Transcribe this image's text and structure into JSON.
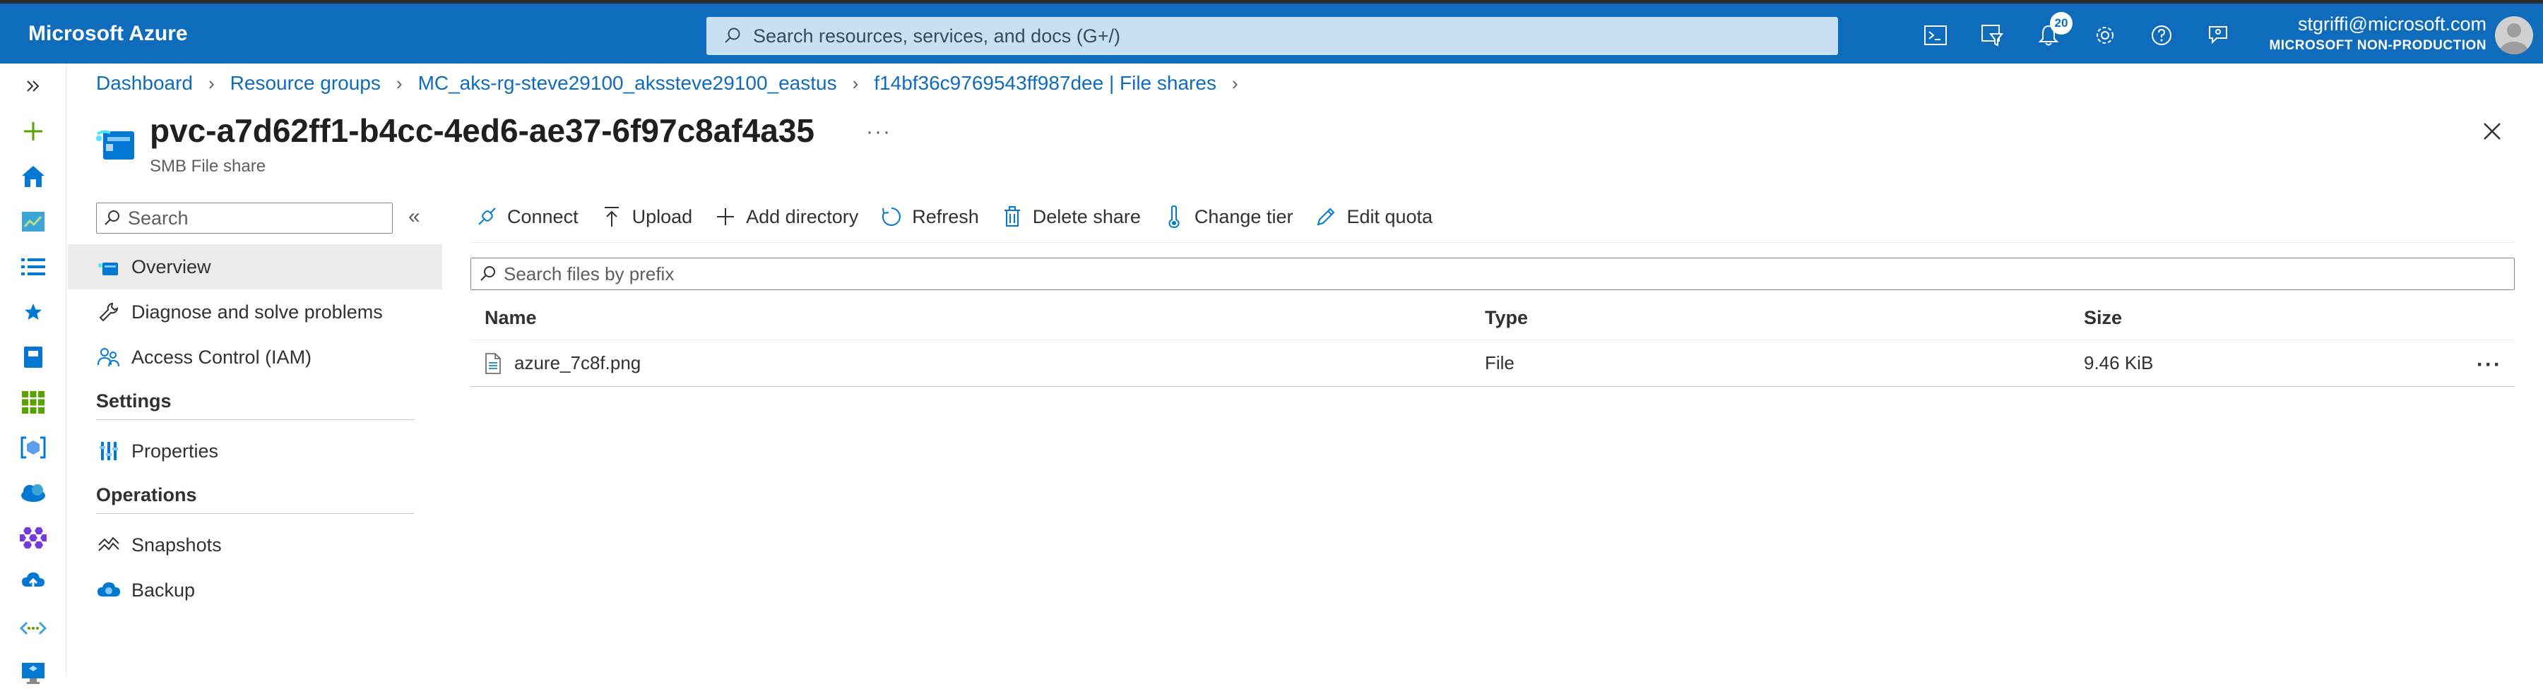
{
  "topbar": {
    "brand": "Microsoft Azure",
    "search_placeholder": "Search resources, services, and docs (G+/)",
    "notifications_count": "20",
    "user": "stgriffi@microsoft.com",
    "tenant": "MICROSOFT NON-PRODUCTION",
    "icons": [
      "cloud-shell-icon",
      "directory-filter-icon",
      "notifications-icon",
      "settings-icon",
      "help-icon",
      "feedback-icon"
    ]
  },
  "breadcrumb": {
    "items": [
      "Dashboard",
      "Resource groups",
      "MC_aks-rg-steve29100_akssteve29100_eastus",
      "f14bf36c9769543ff987dee | File shares"
    ]
  },
  "header": {
    "title": "pvc-a7d62ff1-b4cc-4ed6-ae37-6f97c8af4a35",
    "subtitle": "SMB File share",
    "more": "···"
  },
  "resource_menu": {
    "search_placeholder": "Search",
    "collapse_label": "«",
    "items": [
      {
        "label": "Overview",
        "icon": "file-share-icon",
        "active": true
      },
      {
        "label": "Diagnose and solve problems",
        "icon": "wrench-icon",
        "active": false
      },
      {
        "label": "Access Control (IAM)",
        "icon": "people-icon",
        "active": false
      }
    ],
    "sections": [
      {
        "title": "Settings",
        "items": [
          {
            "label": "Properties",
            "icon": "properties-icon"
          }
        ]
      },
      {
        "title": "Operations",
        "items": [
          {
            "label": "Snapshots",
            "icon": "snapshots-icon"
          },
          {
            "label": "Backup",
            "icon": "backup-icon"
          }
        ]
      }
    ]
  },
  "commands": [
    {
      "label": "Connect",
      "icon": "connect-icon"
    },
    {
      "label": "Upload",
      "icon": "upload-icon"
    },
    {
      "label": "Add directory",
      "icon": "plus-icon"
    },
    {
      "label": "Refresh",
      "icon": "refresh-icon"
    },
    {
      "label": "Delete share",
      "icon": "trash-icon"
    },
    {
      "label": "Change tier",
      "icon": "thermometer-icon"
    },
    {
      "label": "Edit quota",
      "icon": "pencil-icon"
    }
  ],
  "file_search": {
    "placeholder": "Search files by prefix"
  },
  "table": {
    "columns": [
      "Name",
      "Type",
      "Size"
    ],
    "rows": [
      {
        "name": "azure_7c8f.png",
        "type": "File",
        "size": "9.46 KiB",
        "more": "···"
      }
    ]
  },
  "colors": {
    "accent": "#0f6cbd",
    "search_bg": "#c7e0f4",
    "active_menu": "#edebe9"
  }
}
